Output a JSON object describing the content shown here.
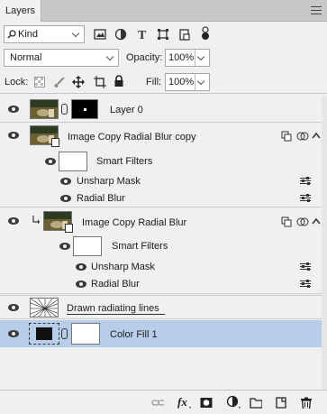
{
  "panel": {
    "tab_label": "Layers"
  },
  "filter": {
    "kind_label": "Kind"
  },
  "blend": {
    "mode": "Normal",
    "opacity_label": "Opacity:",
    "opacity_value": "100%"
  },
  "lock": {
    "label": "Lock:",
    "fill_label": "Fill:",
    "fill_value": "100%"
  },
  "layers": [
    {
      "name": "Layer 0"
    },
    {
      "name": "Image Copy Radial Blur copy",
      "smart_filters_label": "Smart Filters",
      "filters": [
        "Unsharp Mask",
        "Radial Blur"
      ]
    },
    {
      "name": "Image Copy Radial Blur",
      "smart_filters_label": "Smart Filters",
      "filters": [
        "Unsharp Mask",
        "Radial Blur"
      ]
    },
    {
      "name": "Drawn radiating lines"
    },
    {
      "name": "Color Fill 1"
    }
  ],
  "colors": {
    "selected_row": "#b7cde9",
    "panel_bg": "#f0f0f0"
  }
}
